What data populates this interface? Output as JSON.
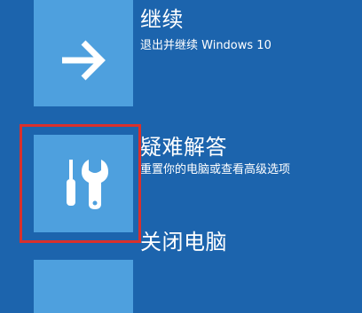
{
  "options": [
    {
      "title": "继续",
      "description": "退出并继续 Windows 10",
      "icon": "arrow-right-icon"
    },
    {
      "title": "疑难解答",
      "description": "重置你的电脑或查看高级选项",
      "icon": "screwdriver-wrench-icon"
    },
    {
      "title": "关闭电脑",
      "description": "",
      "icon": "power-icon"
    }
  ],
  "colors": {
    "background": "#1c64ad",
    "tile": "#4ea0de",
    "highlight": "#d9302c",
    "text": "#ffffff"
  }
}
